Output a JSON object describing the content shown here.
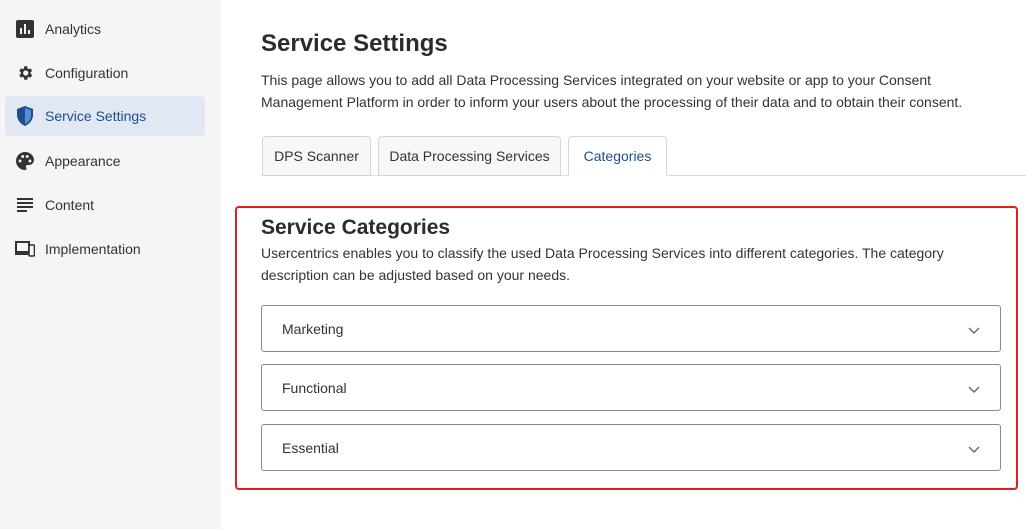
{
  "sidebar": {
    "items": [
      {
        "label": "Analytics",
        "icon": "bar-chart-icon"
      },
      {
        "label": "Configuration",
        "icon": "gear-icon"
      },
      {
        "label": "Service Settings",
        "icon": "shield-icon",
        "active": true
      },
      {
        "label": "Appearance",
        "icon": "palette-icon"
      },
      {
        "label": "Content",
        "icon": "text-lines-icon"
      },
      {
        "label": "Implementation",
        "icon": "devices-icon"
      }
    ]
  },
  "page": {
    "title": "Service Settings",
    "description": "This page allows you to add all Data Processing Services integrated on your website or app to your Consent Management Platform in order to inform your users about the processing of their data and to obtain their consent."
  },
  "tabs": [
    {
      "label": "DPS Scanner"
    },
    {
      "label": "Data Processing Services"
    },
    {
      "label": "Categories",
      "active": true
    }
  ],
  "categories_section": {
    "title": "Service Categories",
    "description": "Usercentrics enables you to classify the used Data Processing Services into different categories. The category description can be adjusted based on your needs.",
    "items": [
      {
        "label": "Marketing"
      },
      {
        "label": "Functional"
      },
      {
        "label": "Essential"
      }
    ]
  },
  "colors": {
    "accent": "#1e4e8c",
    "active_nav_bg": "#e1e8f3",
    "highlight": "#e02020",
    "sidebar_bg": "#f5f5f5"
  }
}
